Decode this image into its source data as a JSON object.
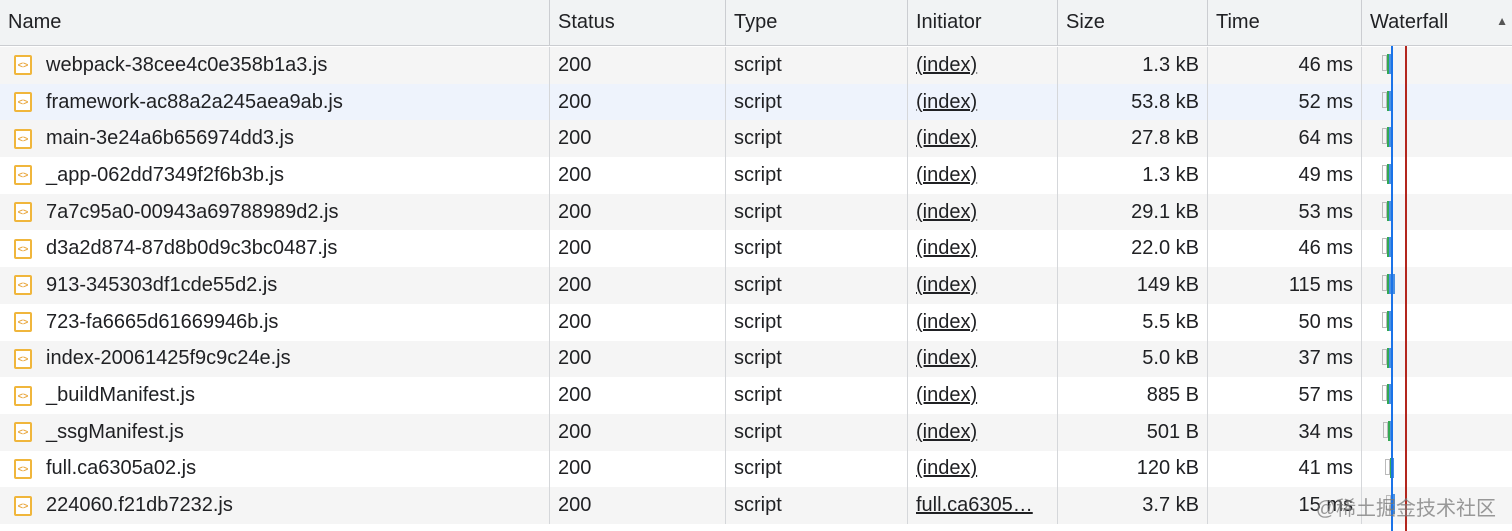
{
  "columns": {
    "name": "Name",
    "status": "Status",
    "type": "Type",
    "initiator": "Initiator",
    "size": "Size",
    "time": "Time",
    "waterfall": "Waterfall"
  },
  "rows": [
    {
      "name": "webpack-38cee4c0e358b1a3.js",
      "status": "200",
      "type": "script",
      "initiator": "(index)",
      "size": "1.3 kB",
      "time": "46 ms"
    },
    {
      "name": "framework-ac88a2a245aea9ab.js",
      "status": "200",
      "type": "script",
      "initiator": "(index)",
      "size": "53.8 kB",
      "time": "52 ms"
    },
    {
      "name": "main-3e24a6b656974dd3.js",
      "status": "200",
      "type": "script",
      "initiator": "(index)",
      "size": "27.8 kB",
      "time": "64 ms"
    },
    {
      "name": "_app-062dd7349f2f6b3b.js",
      "status": "200",
      "type": "script",
      "initiator": "(index)",
      "size": "1.3 kB",
      "time": "49 ms"
    },
    {
      "name": "7a7c95a0-00943a69788989d2.js",
      "status": "200",
      "type": "script",
      "initiator": "(index)",
      "size": "29.1 kB",
      "time": "53 ms"
    },
    {
      "name": "d3a2d874-87d8b0d9c3bc0487.js",
      "status": "200",
      "type": "script",
      "initiator": "(index)",
      "size": "22.0 kB",
      "time": "46 ms"
    },
    {
      "name": "913-345303df1cde55d2.js",
      "status": "200",
      "type": "script",
      "initiator": "(index)",
      "size": "149 kB",
      "time": "115 ms"
    },
    {
      "name": "723-fa6665d61669946b.js",
      "status": "200",
      "type": "script",
      "initiator": "(index)",
      "size": "5.5 kB",
      "time": "50 ms"
    },
    {
      "name": "index-20061425f9c9c24e.js",
      "status": "200",
      "type": "script",
      "initiator": "(index)",
      "size": "5.0 kB",
      "time": "37 ms"
    },
    {
      "name": "_buildManifest.js",
      "status": "200",
      "type": "script",
      "initiator": "(index)",
      "size": "885 B",
      "time": "57 ms"
    },
    {
      "name": "_ssgManifest.js",
      "status": "200",
      "type": "script",
      "initiator": "(index)",
      "size": "501 B",
      "time": "34 ms"
    },
    {
      "name": "full.ca6305a02.js",
      "status": "200",
      "type": "script",
      "initiator": "(index)",
      "size": "120 kB",
      "time": "41 ms"
    },
    {
      "name": "224060.f21db7232.js",
      "status": "200",
      "type": "script",
      "initiator": "full.ca6305…",
      "size": "3.7 kB",
      "time": "15 ms"
    }
  ],
  "icon": "script-file-icon",
  "watermark": "@稀土掘金技术社区",
  "colors": {
    "dom_content_loaded": "#1a73e8",
    "load": "#b3261e",
    "bar_waiting": "#34a853",
    "bar_download": "#4a90e2"
  }
}
